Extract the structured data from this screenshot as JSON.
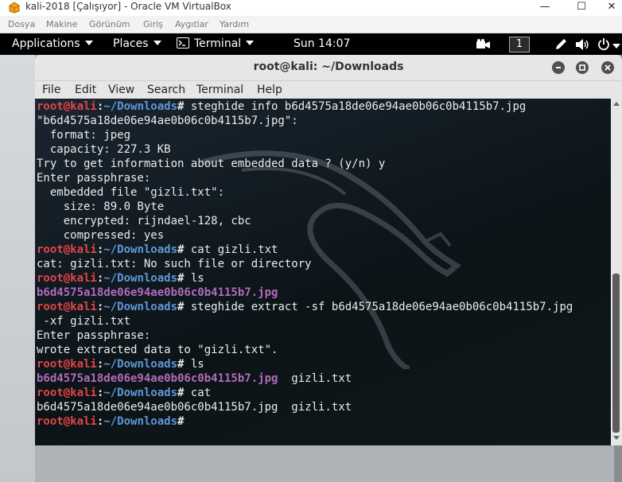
{
  "host": {
    "title": "kali-2018 [Çalışıyor] - Oracle VM VirtualBox",
    "controls": {
      "minimize": "—",
      "maximize": "☐",
      "close": "✕"
    },
    "menu": [
      "Dosya",
      "Makine",
      "Görünüm",
      "Giriş",
      "Aygıtlar",
      "Yardım"
    ]
  },
  "topbar": {
    "applications": "Applications",
    "places": "Places",
    "terminal": "Terminal",
    "clock": "Sun 14:07",
    "workspace": "1"
  },
  "terminal": {
    "title": "root@kali: ~/Downloads",
    "menu": [
      "File",
      "Edit",
      "View",
      "Search",
      "Terminal",
      "Help"
    ],
    "prompt": {
      "user": "root@kali",
      "sep": ":",
      "path": "~/Downloads",
      "symbol": "#"
    },
    "lines": [
      {
        "type": "cmd",
        "text": " steghide info b6d4575a18de06e94ae0b06c0b4115b7.jpg"
      },
      {
        "type": "out",
        "text": "\"b6d4575a18de06e94ae0b06c0b4115b7.jpg\":"
      },
      {
        "type": "out",
        "text": "  format: jpeg"
      },
      {
        "type": "out",
        "text": "  capacity: 227.3 KB"
      },
      {
        "type": "out",
        "text": "Try to get information about embedded data ? (y/n) y"
      },
      {
        "type": "out",
        "text": "Enter passphrase:"
      },
      {
        "type": "out",
        "text": "  embedded file \"gizli.txt\":"
      },
      {
        "type": "out",
        "text": "    size: 89.0 Byte"
      },
      {
        "type": "out",
        "text": "    encrypted: rijndael-128, cbc"
      },
      {
        "type": "out",
        "text": "    compressed: yes"
      },
      {
        "type": "cmd",
        "text": " cat gizli.txt"
      },
      {
        "type": "out",
        "text": "cat: gizli.txt: No such file or directory"
      },
      {
        "type": "cmd",
        "text": " ls"
      },
      {
        "type": "file",
        "text": "b6d4575a18de06e94ae0b06c0b4115b7.jpg"
      },
      {
        "type": "cmd",
        "text": " steghide extract -sf b6d4575a18de06e94ae0b06c0b4115b7.jpg"
      },
      {
        "type": "out",
        "text": " -xf gizli.txt"
      },
      {
        "type": "out",
        "text": "Enter passphrase:"
      },
      {
        "type": "out",
        "text": "wrote extracted data to \"gizli.txt\"."
      },
      {
        "type": "cmd",
        "text": " ls"
      },
      {
        "type": "files",
        "highlight": "b6d4575a18de06e94ae0b06c0b4115b7.jpg",
        "rest": "  gizli.txt"
      },
      {
        "type": "cmd",
        "text": " cat"
      },
      {
        "type": "out",
        "text": "b6d4575a18de06e94ae0b06c0b4115b7.jpg  gizli.txt"
      },
      {
        "type": "cmd",
        "text": ""
      }
    ]
  },
  "colors": {
    "prompt_user": "#e24545",
    "prompt_path": "#5f97d6",
    "file_highlight": "#b06bbc"
  }
}
